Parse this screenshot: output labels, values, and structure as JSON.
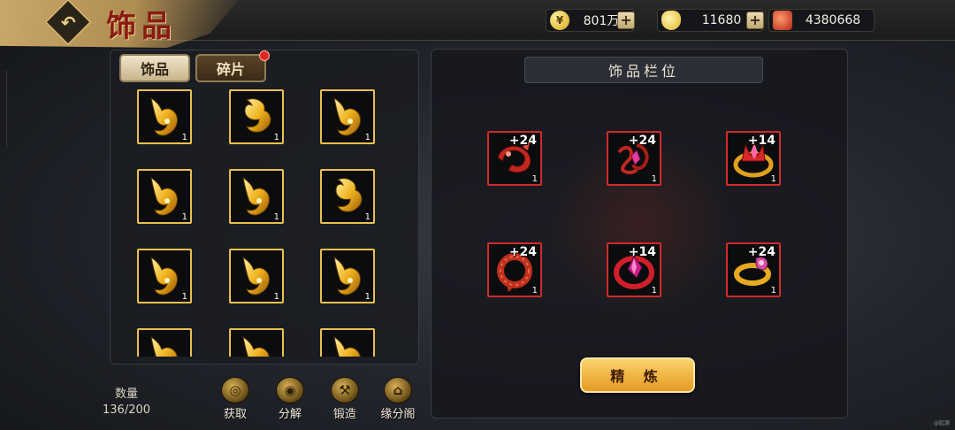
{
  "header": {
    "title": "饰品",
    "back_icon": "back-arrow-icon",
    "currencies": [
      {
        "name": "gold",
        "icon": "gold-coin-icon",
        "value": "801万",
        "has_plus": true
      },
      {
        "name": "ingot",
        "icon": "gold-ingot-icon",
        "value": "11680",
        "has_plus": true
      },
      {
        "name": "gem",
        "icon": "red-gem-icon",
        "value": "4380668",
        "has_plus": false
      }
    ]
  },
  "inventory": {
    "tabs": [
      {
        "label": "饰品",
        "active": true
      },
      {
        "label": "碎片",
        "active": false,
        "has_notification": true
      }
    ],
    "items": [
      {
        "art": "fox-pendant",
        "qty": "1"
      },
      {
        "art": "cloud-pendant",
        "qty": "1"
      },
      {
        "art": "fox-pendant",
        "qty": "1"
      },
      {
        "art": "fox-pendant",
        "qty": "1"
      },
      {
        "art": "fox-pendant",
        "qty": "1"
      },
      {
        "art": "cloud-pendant",
        "qty": "1"
      },
      {
        "art": "fox-pendant",
        "qty": "1"
      },
      {
        "art": "fox-pendant",
        "qty": "1"
      },
      {
        "art": "fox-pendant",
        "qty": "1"
      },
      {
        "art": "fox-pendant",
        "qty": ""
      },
      {
        "art": "fox-pendant",
        "qty": ""
      },
      {
        "art": "fox-pendant",
        "qty": ""
      }
    ],
    "count_label": "数量",
    "count_value": "136/200"
  },
  "equip": {
    "header": "饰品栏位",
    "slots": [
      {
        "art": "red-claw-ring",
        "enhance": "+24",
        "qty": "1"
      },
      {
        "art": "red-crystal-charm",
        "enhance": "+24",
        "qty": "1"
      },
      {
        "art": "gold-crown-ring",
        "enhance": "+14",
        "qty": "1"
      },
      {
        "art": "red-bead-ring",
        "enhance": "+24",
        "qty": "1"
      },
      {
        "art": "ruby-ring",
        "enhance": "+14",
        "qty": "1"
      },
      {
        "art": "gold-gem-ring",
        "enhance": "+24",
        "qty": "1"
      }
    ],
    "refine_label": "精 炼"
  },
  "actions": [
    {
      "label": "获取",
      "icon": "acquire-icon"
    },
    {
      "label": "分解",
      "icon": "decompose-icon"
    },
    {
      "label": "锻造",
      "icon": "hammer-icon"
    },
    {
      "label": "缘分阁",
      "icon": "pavilion-icon"
    }
  ],
  "watermark": "@起源"
}
